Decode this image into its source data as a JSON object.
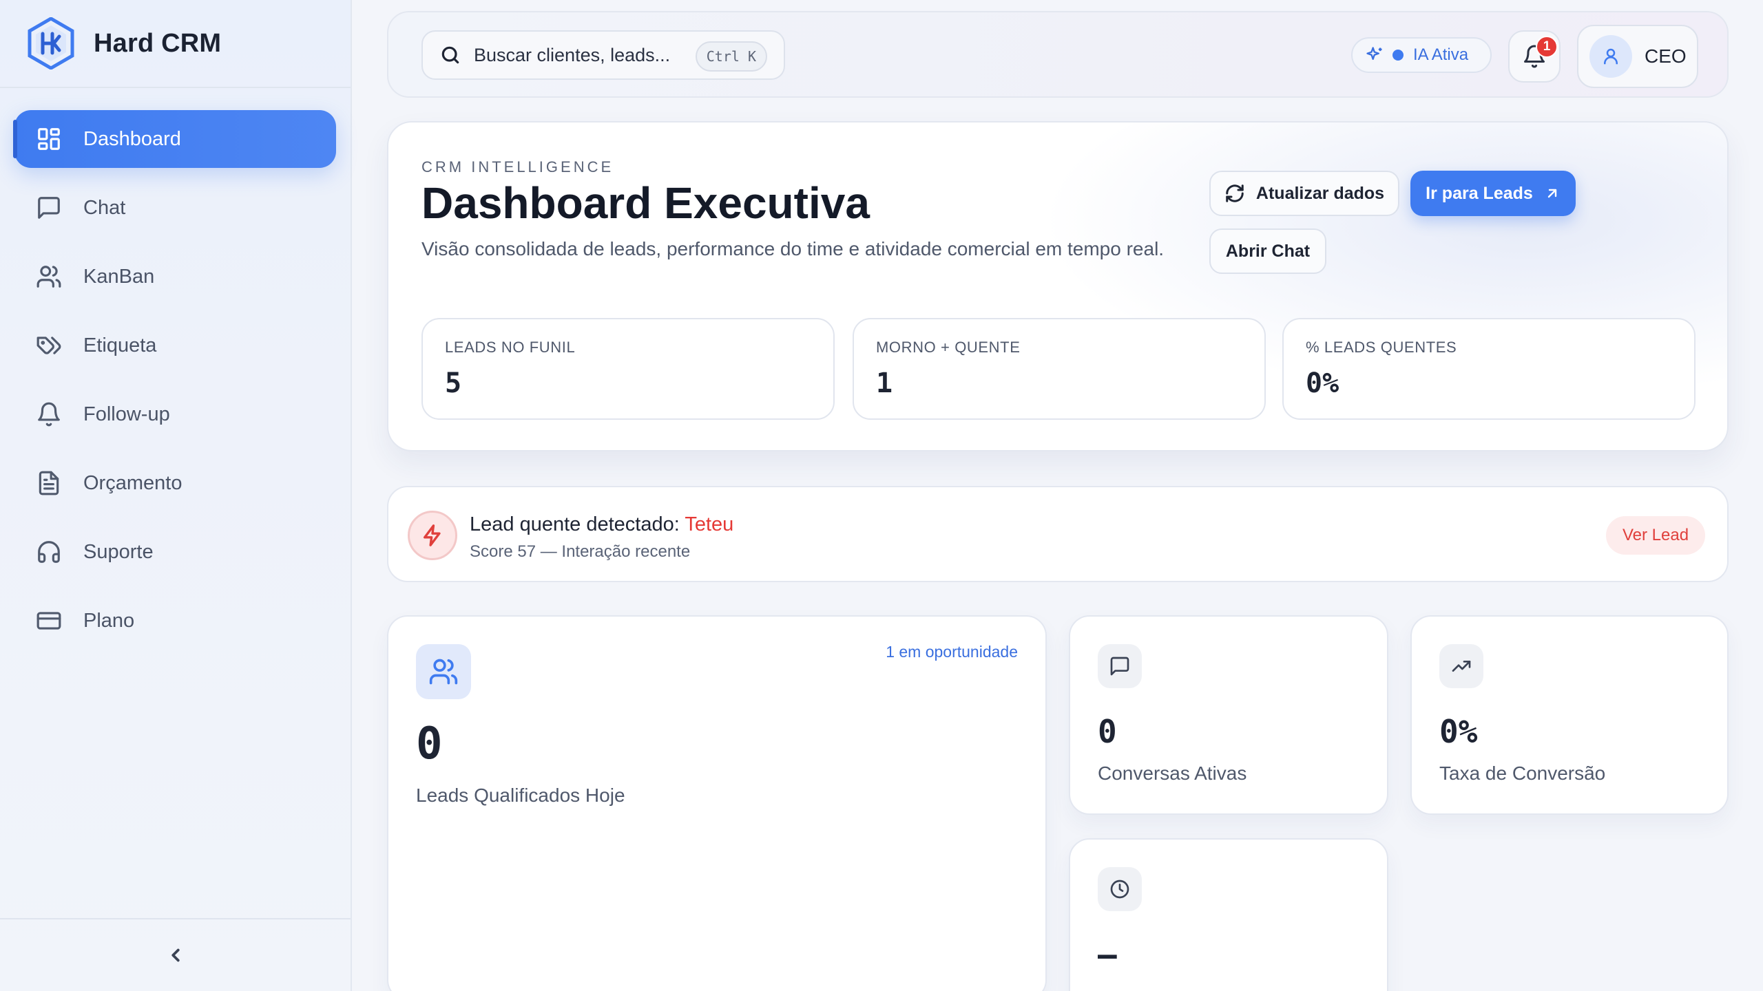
{
  "brand": {
    "name": "Hard CRM"
  },
  "sidebar": {
    "items": [
      {
        "label": "Dashboard",
        "icon": "grid-icon",
        "active": true
      },
      {
        "label": "Chat",
        "icon": "message-icon"
      },
      {
        "label": "KanBan",
        "icon": "users-icon"
      },
      {
        "label": "Etiqueta",
        "icon": "tags-icon"
      },
      {
        "label": "Follow-up",
        "icon": "bell-icon"
      },
      {
        "label": "Orçamento",
        "icon": "document-icon"
      },
      {
        "label": "Suporte",
        "icon": "headset-icon"
      },
      {
        "label": "Plano",
        "icon": "credit-card-icon"
      }
    ],
    "collapse_icon": "chevron-left-icon"
  },
  "topbar": {
    "search_placeholder": "Buscar clientes, leads...",
    "shortcut": "Ctrl K",
    "ai_status": "IA Ativa",
    "notification_count": "1",
    "user_role": "CEO"
  },
  "hero": {
    "eyebrow": "CRM INTELLIGENCE",
    "title": "Dashboard Executiva",
    "subtitle": "Visão consolidada de leads, performance do time e atividade comercial em tempo real.",
    "refresh_label": "Atualizar dados",
    "leads_label": "Ir para Leads",
    "chat_label": "Abrir Chat",
    "metrics": [
      {
        "label": "LEADS NO FUNIL",
        "value": "5"
      },
      {
        "label": "MORNO + QUENTE",
        "value": "1"
      },
      {
        "label": "% LEADS QUENTES",
        "value": "0%"
      }
    ]
  },
  "alert": {
    "title_prefix": "Lead quente detectado: ",
    "lead_name": "Teteu",
    "subtitle": "Score 57 — Interação recente",
    "action_label": "Ver Lead"
  },
  "stats": {
    "qualified": {
      "value": "0",
      "label": "Leads Qualificados Hoje",
      "tag": "1 em oportunidade"
    },
    "conversations": {
      "value": "0",
      "label": "Conversas Ativas"
    },
    "conversion": {
      "value": "0%",
      "label": "Taxa de Conversão"
    },
    "response": {
      "value": "—"
    }
  },
  "colors": {
    "accent": "#3f7bf0",
    "alert": "#e53935",
    "text": "#1e2433"
  }
}
